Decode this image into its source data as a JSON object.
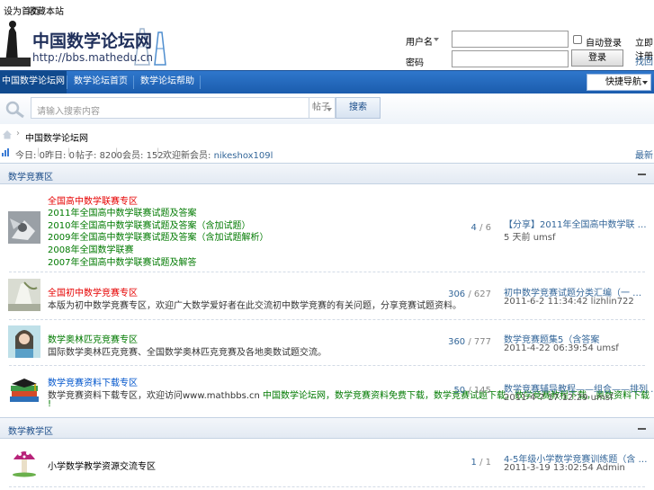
{
  "topbar": {
    "links": [
      "设为首页",
      "收藏本站"
    ]
  },
  "header": {
    "logo_text": "中国数学论坛网",
    "logo_url": "http://bbs.mathedu.cn",
    "username_label": "用户名",
    "password_label": "密码",
    "remember_label": "自动登录",
    "login_button": "登录",
    "register_link": "立即注册",
    "forgot_link": "找回密码"
  },
  "nav": {
    "items": [
      "中国数学论坛网",
      "数学论坛首页",
      "数学论坛帮助"
    ],
    "quick_nav": "快捷导航"
  },
  "search": {
    "placeholder": "请输入搜索内容",
    "type": "帖子",
    "button": "搜索"
  },
  "breadcrumb": {
    "current": "中国数学论坛网"
  },
  "stats": {
    "today_label": "今日",
    "today": "0",
    "yesterday_label": "昨日",
    "yesterday": "0",
    "posts_label": "帖子",
    "posts": "8200",
    "members_label": "会员",
    "members": "152",
    "newest_label": "欢迎新会员",
    "newest": "nikeshox109l",
    "right_link": "最新回复"
  },
  "sections": [
    {
      "title": "数学竞赛区",
      "forums": [
        {
          "title": "全国高中数学联赛专区",
          "title_color": "#e60000",
          "lines": [
            {
              "text": "2011年全国高中数学联赛试题及答案",
              "color": "#007a00"
            },
            {
              "text": "2010年全国高中数学联赛试题及答案（含加试题）",
              "color": "#007a00"
            },
            {
              "text": "2009年全国高中数学联赛试题及答案（含加试题解析）",
              "color": "#007a00"
            },
            {
              "text": "2008年全国数学联赛",
              "color": "#007a00"
            },
            {
              "text": "2007年全国高中数学联赛试题及解答",
              "color": "#007a00"
            }
          ],
          "threads": "4",
          "posts": "6",
          "last_title": "【分享】2011年全国高中数学联 …",
          "last_meta": "5 天前 umsf"
        },
        {
          "title": "全国初中数学竞赛专区",
          "title_color": "#e60000",
          "lines": [
            {
              "text": "本版为初中数学竞赛专区，欢迎广大数学爱好者在此交流初中数学竞赛的有关问题，分享竞赛试题资料。",
              "color": "#333"
            }
          ],
          "threads": "306",
          "posts": "627",
          "last_title": "初中数学竞赛试题分类汇编（一 …",
          "last_meta": "2011-6-2 11:34:42 lizhlin722"
        },
        {
          "title": "数学奥林匹克竞赛专区",
          "title_color": "#007a00",
          "lines": [
            {
              "text": "国际数学奥林匹克竞赛、全国数学奥林匹克竞赛及各地奥数试题交流。",
              "color": "#333"
            }
          ],
          "threads": "360",
          "posts": "777",
          "last_title": "数学竞赛题集5（含答案",
          "last_meta": "2011-4-22 06:39:54 umsf"
        },
        {
          "title": "数学竞赛资料下载专区",
          "title_color": "#0055cc",
          "lines": [
            {
              "text": "数学竞赛资料下载专区，欢迎访问www.mathbbs.cn ",
              "color": "#333",
              "extra": "中国数学论坛网，数学竞赛资料免费下载，数学竞赛试题下载，数学竞赛教程下载，奥数资料下载",
              "extra_color": "#007a00"
            },
            {
              "text": "!",
              "color": "#007a00"
            }
          ],
          "threads": "50",
          "posts": "145",
          "last_title": "数学竞赛辅导教程——组合——排列 …",
          "last_meta": "2011-4-7 17:12:29 umsf"
        }
      ]
    },
    {
      "title": "数学教学区",
      "forums": [
        {
          "title": "小学数学教学资源交流专区",
          "title_color": "#000000",
          "lines": [],
          "threads": "1",
          "posts": "1",
          "last_title": "4-5年级小学数学竞赛训练题（含 …",
          "last_meta": "2011-3-19 13:02:54 Admin"
        }
      ]
    }
  ]
}
